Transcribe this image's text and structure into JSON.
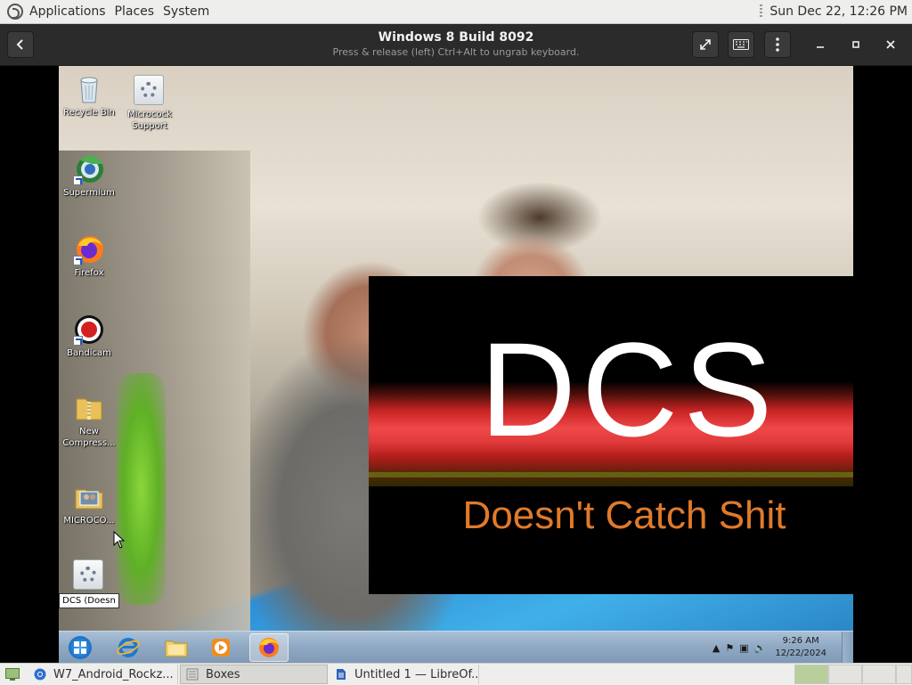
{
  "top_panel": {
    "menu": [
      "Applications",
      "Places",
      "System"
    ],
    "clock": "Sun Dec 22, 12:26 PM"
  },
  "boxes_header": {
    "title": "Windows 8 Build 8092",
    "hint": "Press & release (left) Ctrl+Alt to ungrab keyboard."
  },
  "desktop_icons": [
    {
      "label": "Recycle Bin",
      "icon": "recycle-bin-icon"
    },
    {
      "label": "Microcock Support",
      "icon": "settings-gear-icon"
    },
    {
      "label": "Supermium",
      "icon": "supermium-icon"
    },
    {
      "label": "Firefox",
      "icon": "firefox-icon"
    },
    {
      "label": "Bandicam",
      "icon": "bandicam-icon"
    },
    {
      "label": "New Compress...",
      "icon": "zip-folder-icon"
    },
    {
      "label": "MICROCO...",
      "icon": "image-folder-icon"
    },
    {
      "label": "DCS (Doesn",
      "icon": "settings-gear-icon"
    }
  ],
  "dcs": {
    "letters": "DCS",
    "tagline": "Doesn't Catch Shit"
  },
  "win_taskbar": {
    "clock_time": "9:26 AM",
    "clock_date": "12/22/2024"
  },
  "bottom_panel": {
    "tasks": [
      {
        "label": "W7_Android_Rockz..."
      },
      {
        "label": "Boxes"
      },
      {
        "label": "Untitled 1 — LibreOf..."
      }
    ]
  }
}
